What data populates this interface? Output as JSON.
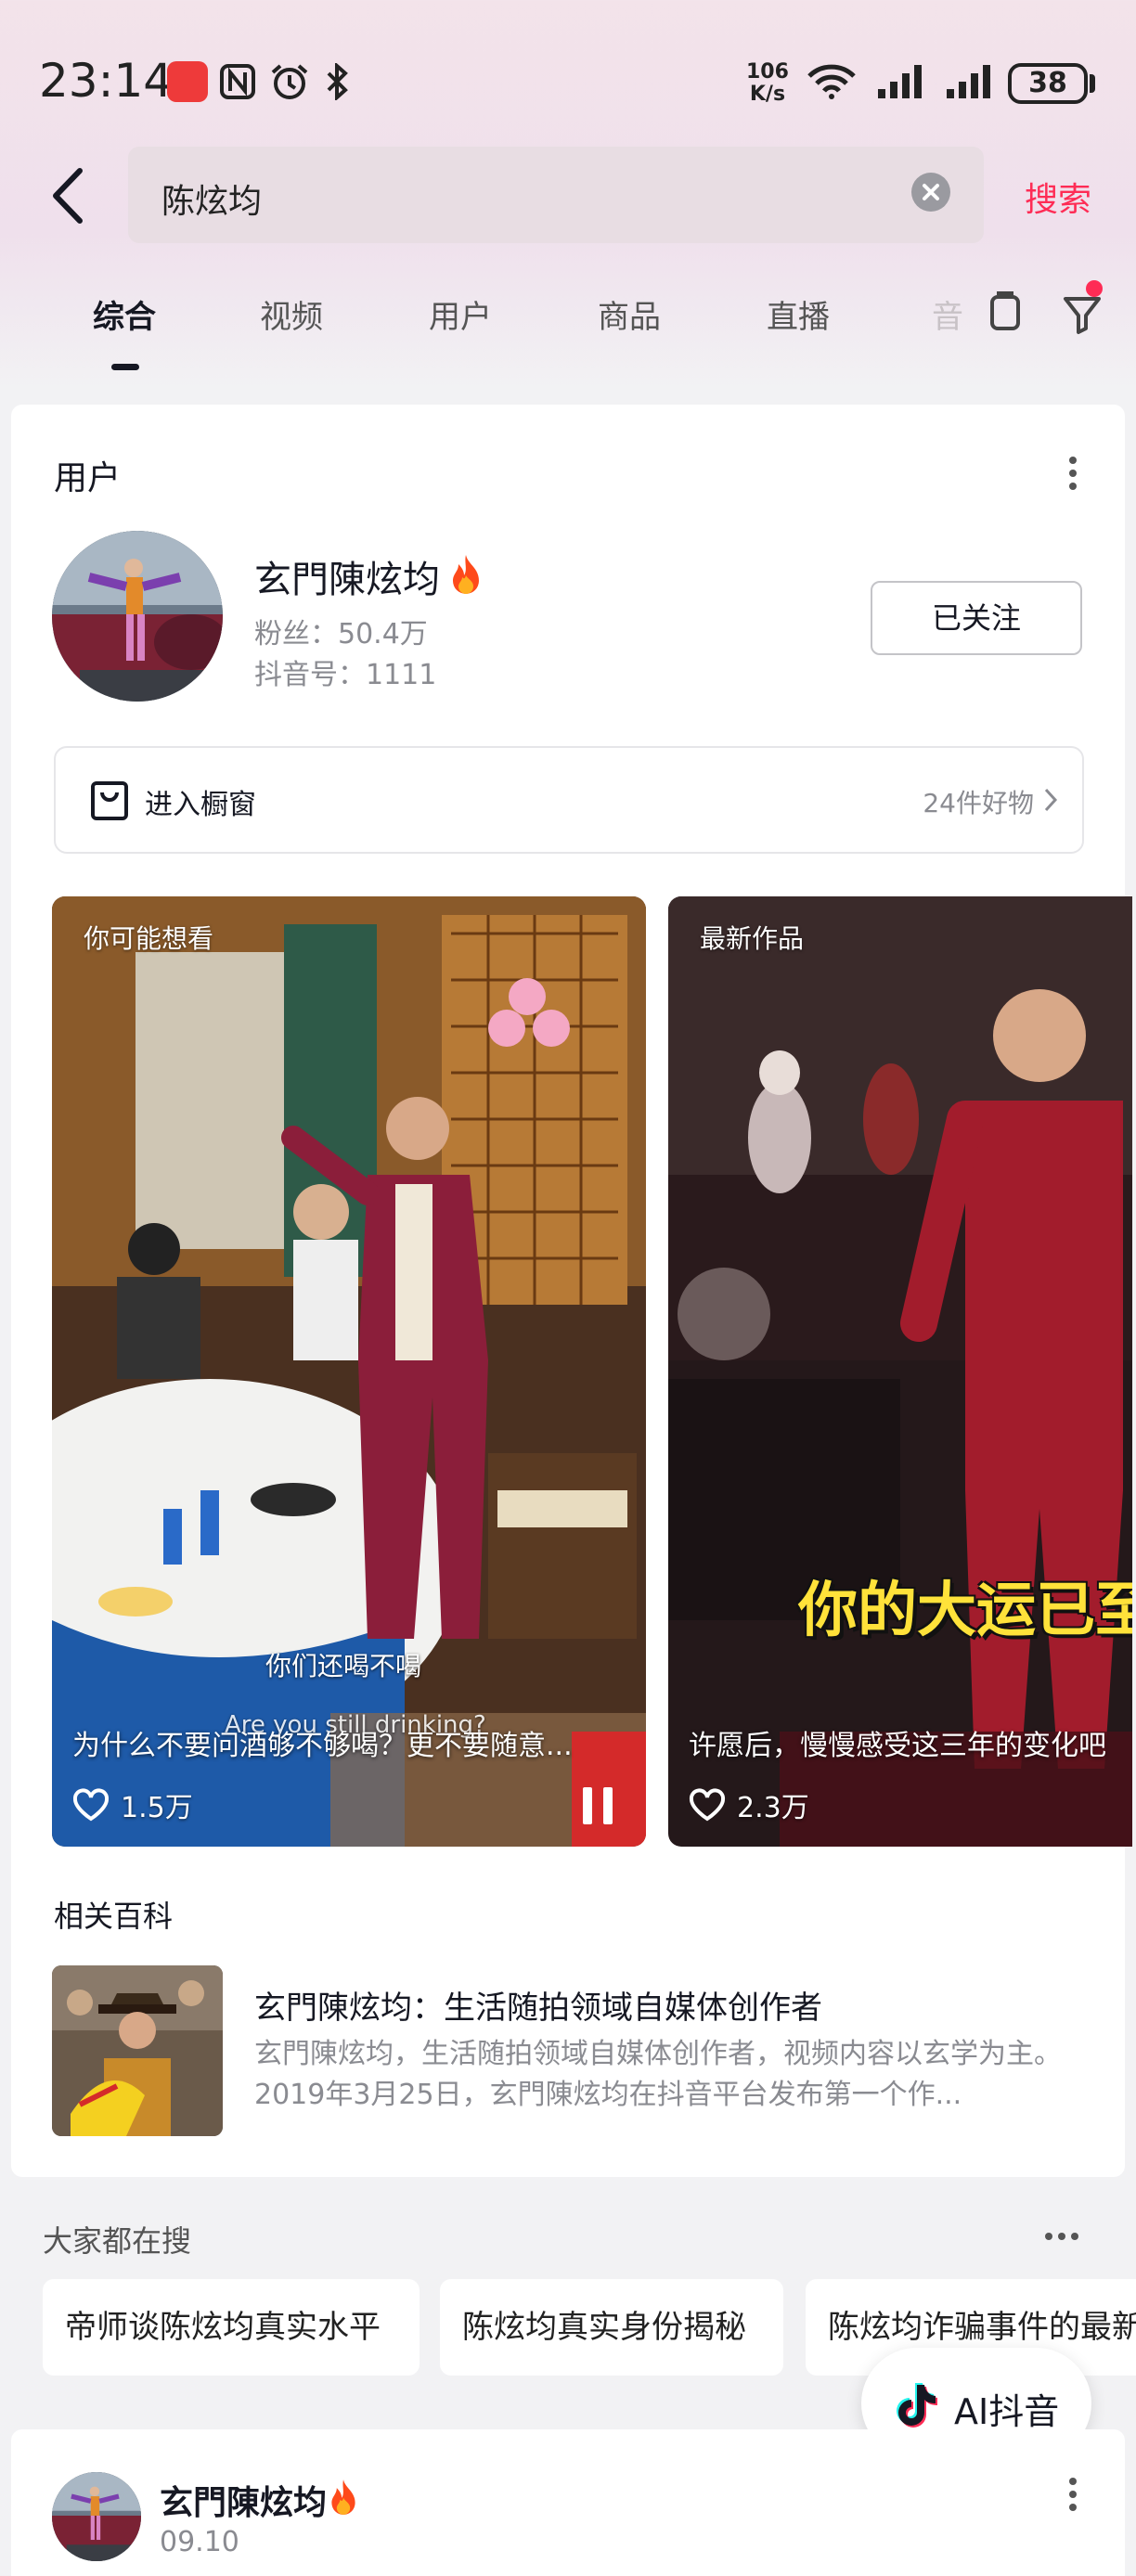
{
  "status_bar": {
    "time": "23:14",
    "net_speed_value": "106",
    "net_speed_unit": "K/s",
    "battery": "38"
  },
  "search": {
    "query": "陈炫均",
    "submit_label": "搜索"
  },
  "tabs": [
    {
      "label": "综合",
      "active": true
    },
    {
      "label": "视频",
      "active": false
    },
    {
      "label": "用户",
      "active": false
    },
    {
      "label": "商品",
      "active": false
    },
    {
      "label": "直播",
      "active": false
    },
    {
      "label": "音",
      "active": false
    }
  ],
  "user_section": {
    "title": "用户",
    "user": {
      "name": "玄門陳炫均",
      "fans": "粉丝：50.4万",
      "douyin_id": "抖音号：1111",
      "follow_label": "已关注"
    },
    "shop": {
      "label": "进入橱窗",
      "count": "24件好物"
    }
  },
  "videos": [
    {
      "tag": "你可能想看",
      "subtitle": "你们还喝不喝",
      "subtitle_en": "Are you still drinking?",
      "caption": "为什么不要问酒够不够喝？更不要随意...",
      "likes": "1.5万"
    },
    {
      "tag": "最新作品",
      "overlay_text": "你的大运已至",
      "caption": "许愿后，慢慢感受这三年的变化吧",
      "likes": "2.3万"
    }
  ],
  "wiki": {
    "section_title": "相关百科",
    "title": "玄門陳炫均：生活随拍领域自媒体创作者",
    "desc": "玄門陳炫均，生活随拍领域自媒体创作者，视频内容以玄学为主。2019年3月25日，玄門陳炫均在抖音平台发布第一个作..."
  },
  "hot_search": {
    "title": "大家都在搜",
    "items": [
      "帝师谈陈炫均真实水平",
      "陈炫均真实身份揭秘",
      "陈炫均诈骗事件的最新"
    ]
  },
  "ai_button": {
    "label": "AI抖音"
  },
  "post": {
    "author": "玄門陳炫均",
    "date": "09.10"
  },
  "colors": {
    "accent": "#fe2c55",
    "text_primary": "#161823",
    "text_secondary": "#8a8b91"
  }
}
